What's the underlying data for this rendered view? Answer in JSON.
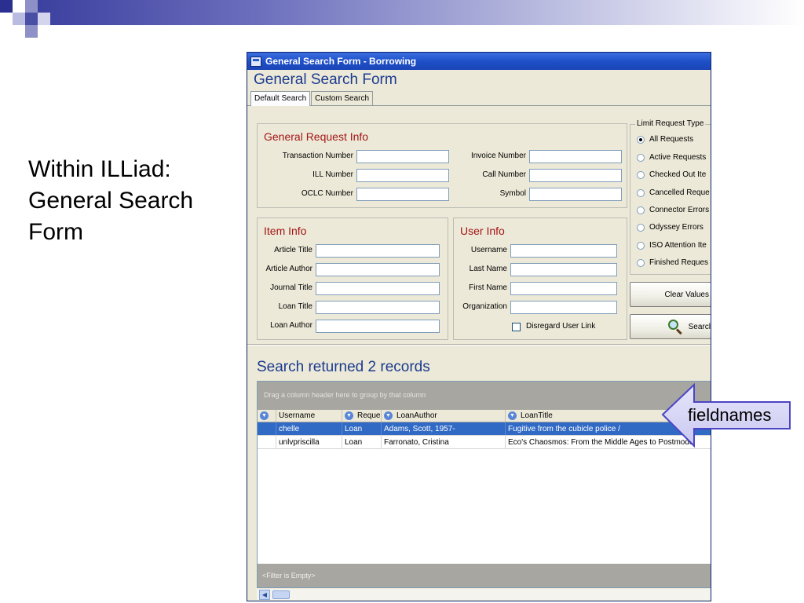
{
  "slide": {
    "title_lines": [
      "Within ILLiad:",
      "General Search",
      "Form"
    ]
  },
  "window": {
    "title": "General Search Form - Borrowing",
    "heading": "General Search Form",
    "tabs": [
      {
        "label": "Default Search",
        "active": true
      },
      {
        "label": "Custom Search",
        "active": false
      }
    ]
  },
  "general_request": {
    "title": "General Request Info",
    "left_fields": [
      {
        "label": "Transaction Number",
        "value": ""
      },
      {
        "label": "ILL Number",
        "value": ""
      },
      {
        "label": "OCLC Number",
        "value": ""
      }
    ],
    "right_fields": [
      {
        "label": "Invoice Number",
        "value": ""
      },
      {
        "label": "Call Number",
        "value": ""
      },
      {
        "label": "Symbol",
        "value": ""
      }
    ]
  },
  "item_info": {
    "title": "Item Info",
    "fields": [
      {
        "label": "Article Title",
        "value": ""
      },
      {
        "label": "Article Author",
        "value": ""
      },
      {
        "label": "Journal Title",
        "value": ""
      },
      {
        "label": "Loan Title",
        "value": ""
      },
      {
        "label": "Loan Author",
        "value": ""
      }
    ]
  },
  "user_info": {
    "title": "User Info",
    "fields": [
      {
        "label": "Username",
        "value": ""
      },
      {
        "label": "Last Name",
        "value": ""
      },
      {
        "label": "First Name",
        "value": ""
      },
      {
        "label": "Organization",
        "value": ""
      }
    ],
    "disregard_label": "Disregard User Link",
    "disregard_checked": false
  },
  "limit": {
    "legend": "Limit Request Type",
    "options": [
      {
        "label": "All Requests",
        "checked": true
      },
      {
        "label": "Active Requests",
        "checked": false
      },
      {
        "label": "Checked Out Ite",
        "checked": false
      },
      {
        "label": "Cancelled Reque",
        "checked": false
      },
      {
        "label": "Connector Errors",
        "checked": false
      },
      {
        "label": "Odyssey Errors",
        "checked": false
      },
      {
        "label": "ISO Attention Ite",
        "checked": false
      },
      {
        "label": "Finished Reques",
        "checked": false
      }
    ]
  },
  "buttons": {
    "clear": "Clear Values",
    "search": "Searcl"
  },
  "results": {
    "heading": "Search returned 2 records",
    "group_panel_text": "Drag a column header here to group by that column",
    "columns": [
      "Username",
      "Reque",
      "LoanAuthor",
      "LoanTitle"
    ],
    "rows": [
      {
        "cells": [
          "chelle",
          "Loan",
          "Adams, Scott, 1957-",
          "Fugitive from the cubicle police /"
        ],
        "selected": true
      },
      {
        "cells": [
          "unlvpriscilla",
          "Loan",
          "Farronato, Cristina",
          "Eco's Chaosmos: From the Middle Ages to Postmode"
        ],
        "selected": false
      }
    ],
    "filter_text": "<Filter is Empty>"
  },
  "callout": {
    "text": "fieldnames"
  },
  "colors": {
    "accent": "#1b3b8f",
    "group_title": "#a31515",
    "selection": "#316ac5",
    "titlebar": "#1f50c9"
  }
}
